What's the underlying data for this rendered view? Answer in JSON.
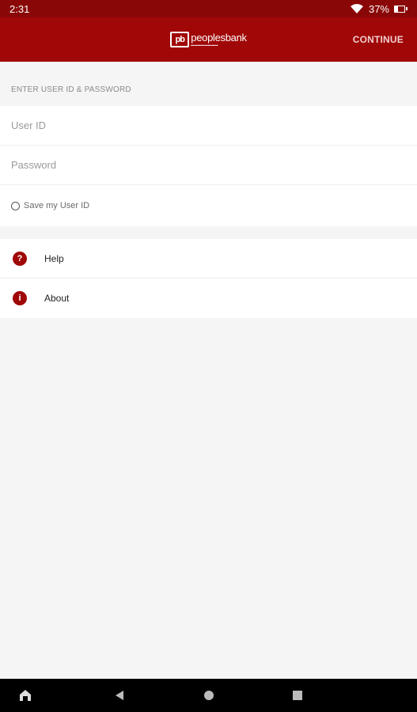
{
  "status_bar": {
    "time": "2:31",
    "battery": "37%",
    "battery_level": 0.37
  },
  "app_bar": {
    "logo_mark": "pb",
    "logo_name": "peoplesbank",
    "continue_label": "CONTINUE"
  },
  "login": {
    "section_label": "ENTER USER ID & PASSWORD",
    "user_id_placeholder": "User ID",
    "password_placeholder": "Password",
    "save_user_id_label": "Save my User ID"
  },
  "menu": {
    "items": [
      {
        "label": "Help",
        "icon": "help-icon",
        "glyph": "?"
      },
      {
        "label": "About",
        "icon": "info-icon",
        "glyph": "i"
      }
    ]
  },
  "colors": {
    "brand": "#a00707",
    "status_bar": "#8a0707",
    "background": "#f5f5f5"
  }
}
